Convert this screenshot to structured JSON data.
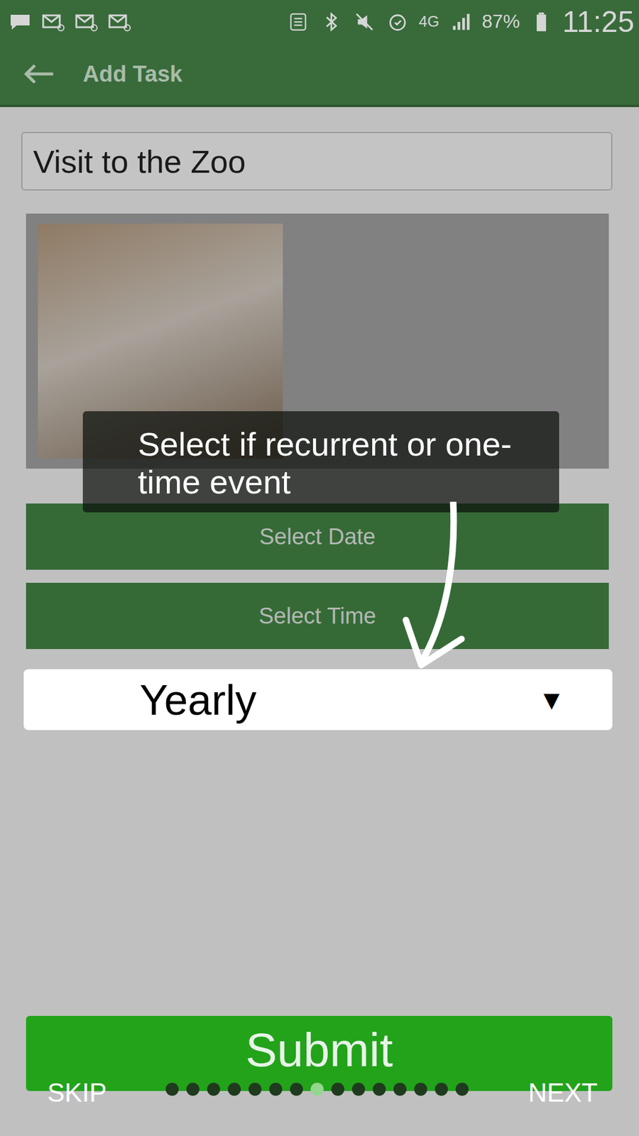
{
  "status_bar": {
    "network": "4G",
    "battery": "87%",
    "time": "11:25"
  },
  "app_bar": {
    "title": "Add Task"
  },
  "task_name": "Visit to the Zoo",
  "buttons": [
    "Select Date",
    "Select Time"
  ],
  "repeat": {
    "value": "Yearly",
    "arrow": "▼"
  },
  "submit": "Submit",
  "tooltip": "Select if recurrent or one-time event",
  "tour": {
    "skip": "SKIP",
    "next": "NEXT",
    "steps": [
      {
        "selected": false
      },
      {
        "selected": false
      },
      {
        "selected": false
      },
      {
        "selected": false
      },
      {
        "selected": false
      },
      {
        "selected": false
      },
      {
        "selected": false
      },
      {
        "selected": true
      },
      {
        "selected": false
      },
      {
        "selected": false
      },
      {
        "selected": false
      },
      {
        "selected": false
      },
      {
        "selected": false
      },
      {
        "selected": false
      },
      {
        "selected": false
      }
    ]
  }
}
